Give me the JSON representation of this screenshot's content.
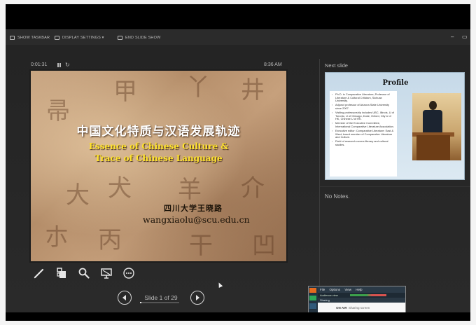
{
  "toolbar": {
    "show_taskbar": "SHOW TASKBAR",
    "display_settings": "DISPLAY SETTINGS ▾",
    "end_slide_show": "END SLIDE SHOW",
    "minimize": "–",
    "restore": "▭"
  },
  "presenter": {
    "timer": "0:01:31",
    "clock": "8:36 AM",
    "next_slide_label": "Next slide",
    "no_notes": "No Notes.",
    "slide_counter": "Slide 1 of 29",
    "progress_fraction": 0.034
  },
  "current_slide": {
    "title_cn": "中国文化特质与汉语发展轨迹",
    "title_en_line1": "Essence of Chinese Culture &",
    "title_en_line2": "Trace of Chinese Language",
    "author": "四川大学王晓路",
    "email": "wangxiaolu@scu.edu.cn",
    "background_glyphs": [
      "甲",
      "丫",
      "井",
      "帚",
      "大",
      "犬",
      "羊",
      "介",
      "朩",
      "丙",
      "干",
      "凹"
    ]
  },
  "next_slide": {
    "title": "Profile",
    "bullets": [
      "Ph.D. in Comparative Literature; Professor of Literature & Cultural Criticism, Sichuan University.",
      "Adjunct professor of Arizona State University  since 2007.",
      "Visiting professorship includes UBC, Illinois, U of Toronto, U of Chicago, Duke, Oxford, City U of HK, Chinese U of HK.",
      "Member of the Executive Committee, International Comparative Literature Association.",
      "Executive editor: Comparative Literature: East & West; board member of Comparative Literature and Culture.",
      "Field of research covers literary and cultural studies."
    ]
  },
  "tools": [
    {
      "name": "pen-tool-icon"
    },
    {
      "name": "see-all-slides-icon"
    },
    {
      "name": "zoom-icon"
    },
    {
      "name": "black-screen-icon"
    },
    {
      "name": "more-options-icon"
    }
  ],
  "hangouts": {
    "menu": [
      "File",
      "Options",
      "View",
      "Help"
    ],
    "audio": "Audience view",
    "sharing": "Sharing",
    "live_label": "ON AIR",
    "status": "Sharing screen"
  },
  "colors": {
    "accent_yellow": "#ffe32d",
    "presenter_bg": "#252525",
    "hangouts_orange": "#e56b1f",
    "hangouts_green": "#2eaa58"
  }
}
